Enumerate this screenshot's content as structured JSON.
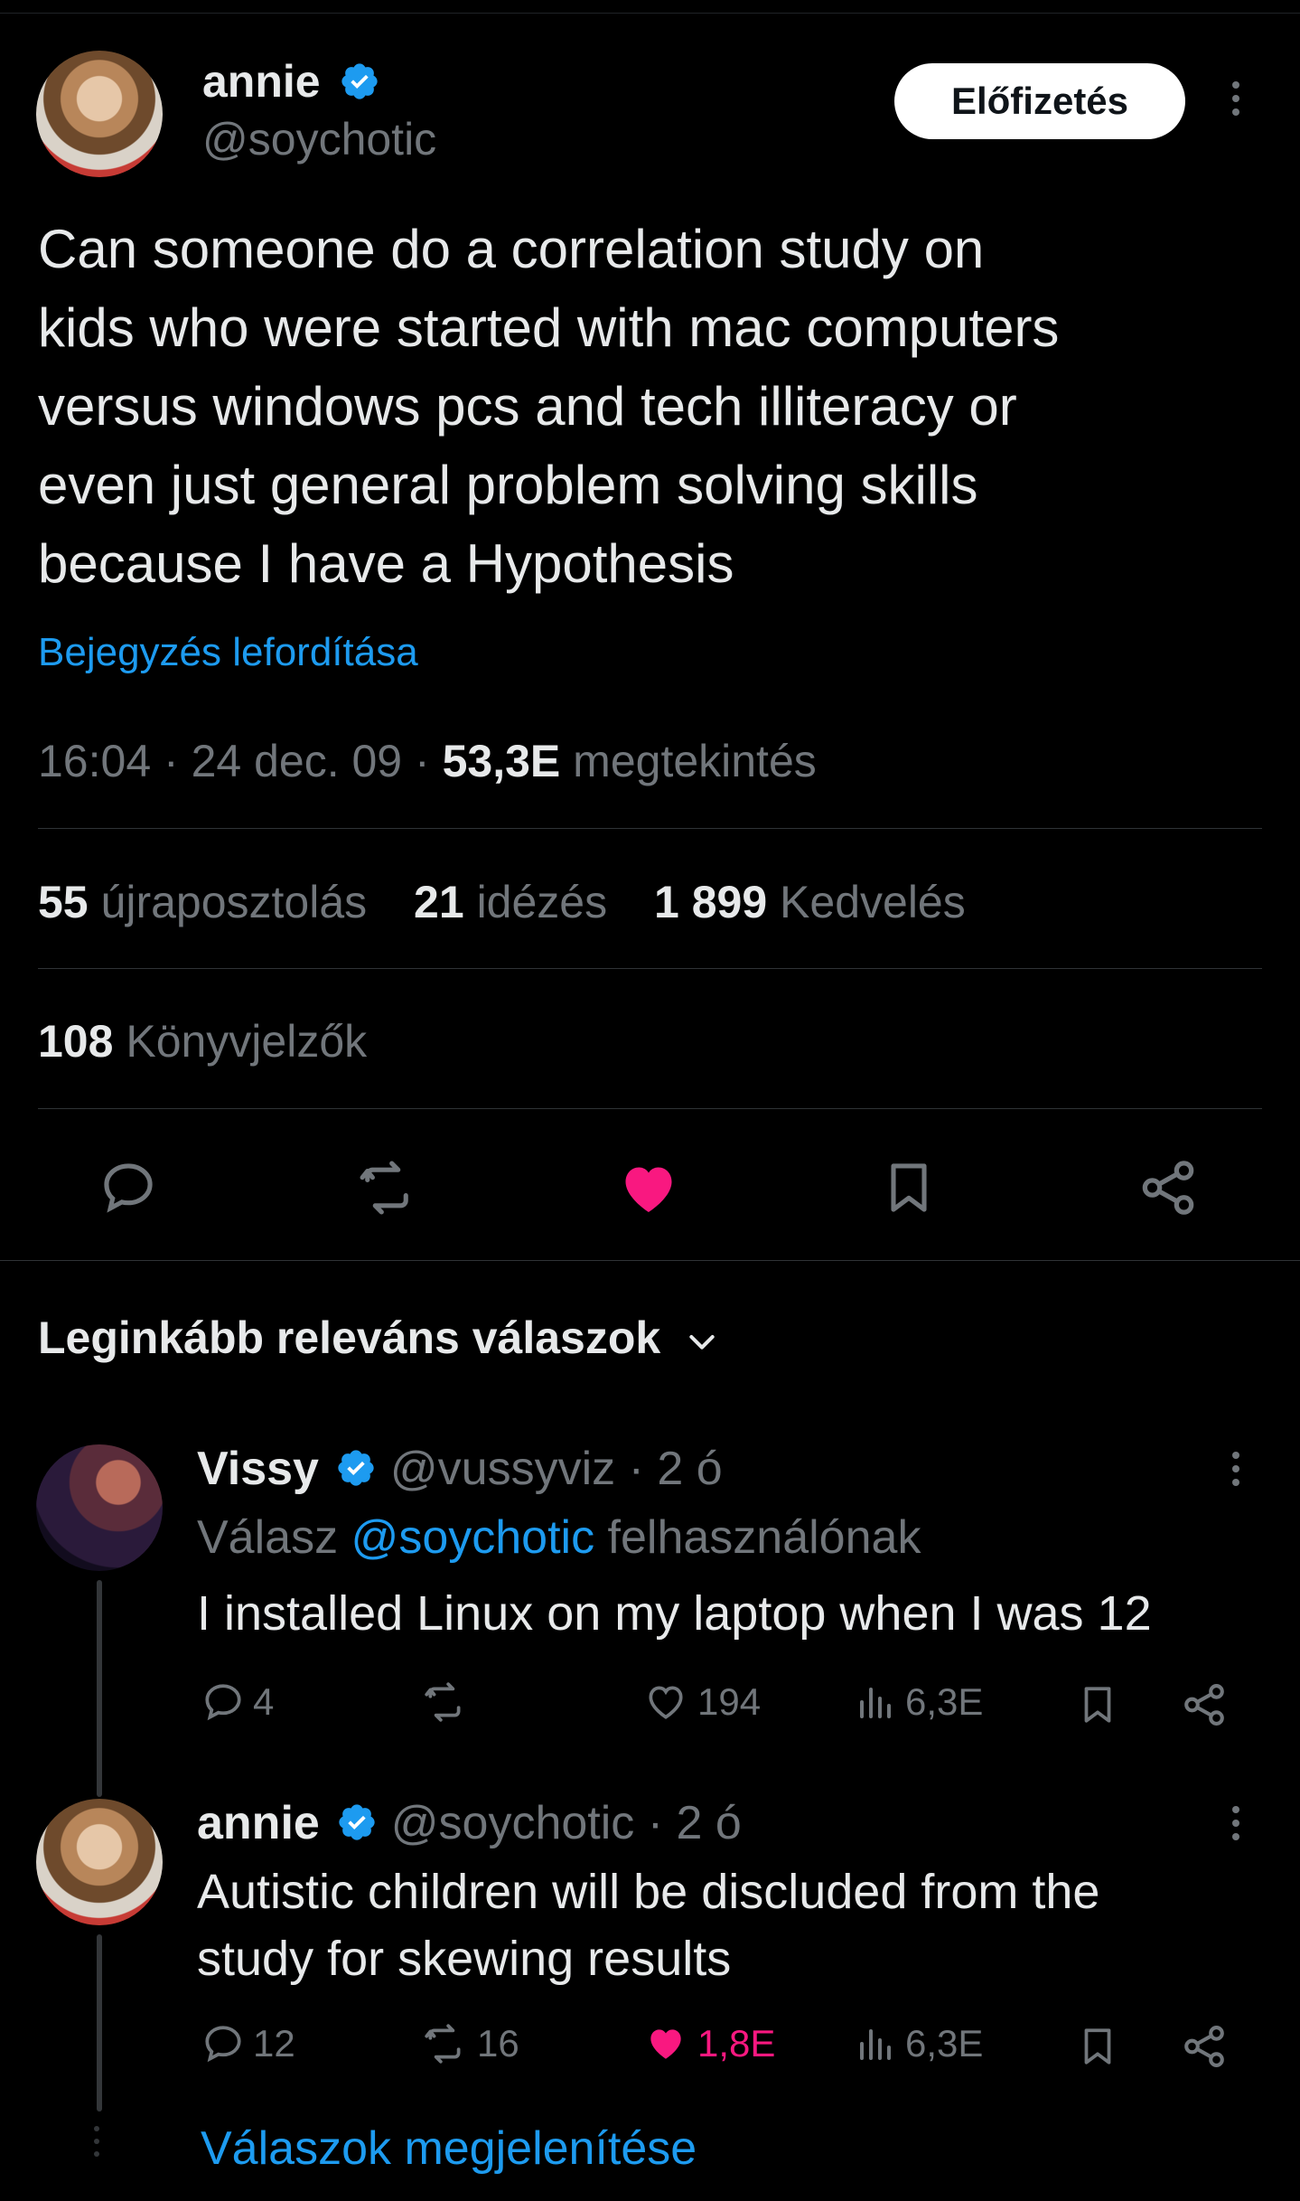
{
  "tweet": {
    "author_name": "annie",
    "author_handle": "@soychotic",
    "subscribe_label": "Előfizetés",
    "text_lines": [
      "Can someone do a correlation study on",
      "kids who were started with mac computers",
      "versus windows pcs and tech illiteracy or",
      "even just general problem solving skills",
      "because I have a Hypothesis"
    ],
    "translate_label": "Bejegyzés lefordítása",
    "time": "16:04",
    "date": "24 dec. 09",
    "sep": "·",
    "views_count": "53,3E",
    "views_label": "megtekintés",
    "reposts_count": "55",
    "reposts_label": "újraposztolás",
    "quotes_count": "21",
    "quotes_label": "idézés",
    "likes_count": "1 899",
    "likes_label": "Kedvelés",
    "bookmarks_count": "108",
    "bookmarks_label": "Könyvjelzők"
  },
  "replies_header": "Leginkább releváns válaszok",
  "replies": [
    {
      "author_name": "Vissy",
      "author_handle": "@vussyviz",
      "time": "· 2 ó",
      "reply_to_prefix": "Válasz",
      "reply_to_handle": "@soychotic",
      "reply_to_suffix": "felhasználónak",
      "text_lines": [
        "I installed Linux on my laptop when I was 12"
      ],
      "reply_count": "4",
      "repost_count": "",
      "like_count": "194",
      "view_count": "6,3E"
    },
    {
      "author_name": "annie",
      "author_handle": "@soychotic",
      "time": "· 2 ó",
      "text_lines": [
        "Autistic children will be discluded from the",
        "study for skewing results"
      ],
      "reply_count": "12",
      "repost_count": "16",
      "like_count": "1,8E",
      "view_count": "6,3E"
    }
  ],
  "show_replies_label": "Válaszok megjelenítése",
  "colors": {
    "background": "#000000",
    "text": "#e7e9ea",
    "muted": "#71767b",
    "accent": "#1d9bf0",
    "like": "#f91880",
    "divider": "#2f3336"
  },
  "icons": [
    "verified-badge-icon",
    "more-icon",
    "reply-icon",
    "repost-icon",
    "like-icon",
    "bookmark-icon",
    "share-icon",
    "views-icon",
    "chevron-down-icon"
  ]
}
